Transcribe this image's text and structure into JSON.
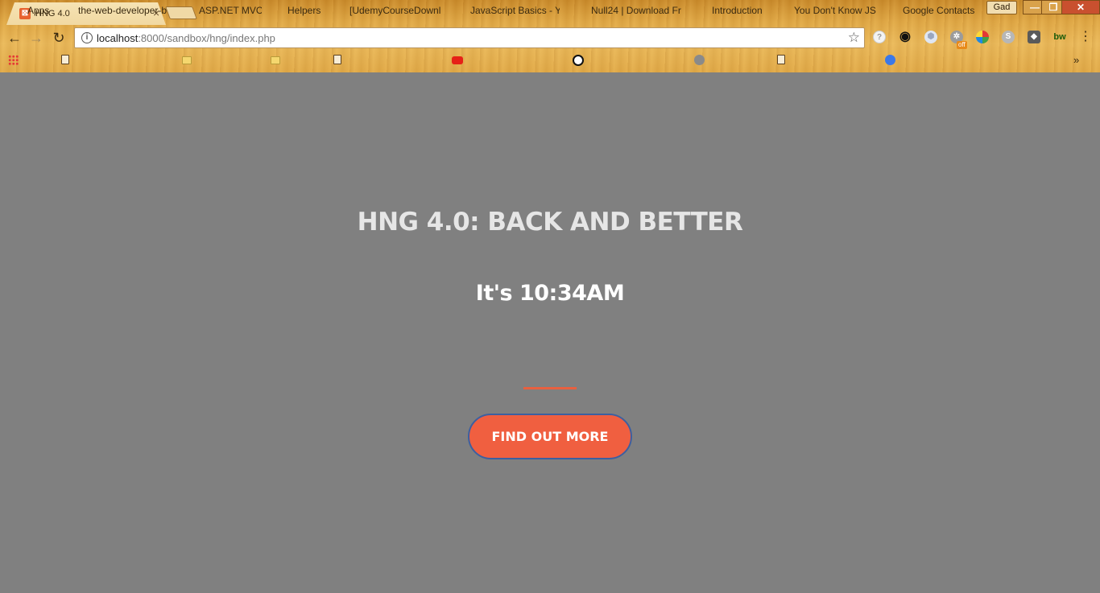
{
  "browser": {
    "tab": {
      "title": "HNG 4.0",
      "close": "×"
    },
    "profile": "Gad",
    "window_controls": {
      "minimize": "—",
      "maximize": "❐",
      "close": "✕"
    },
    "address": {
      "host": "localhost",
      "rest": ":8000/sandbox/hng/index.php"
    },
    "bookmarks": [
      {
        "label": "Apps",
        "icon": "apps-grid-icon"
      },
      {
        "label": "the-web-developer-b",
        "icon": "page-icon"
      },
      {
        "label": "ASP.NET MVC",
        "icon": "folder-icon"
      },
      {
        "label": "Helpers",
        "icon": "folder-icon"
      },
      {
        "label": "[UdemyCourseDownl",
        "icon": "page-icon"
      },
      {
        "label": "JavaScript Basics - Yo",
        "icon": "youtube-icon"
      },
      {
        "label": "Null24 | Download Fr",
        "icon": "clock-icon"
      },
      {
        "label": "Introduction",
        "icon": "gear-icon"
      },
      {
        "label": "You Don't Know JS",
        "icon": "page-icon"
      },
      {
        "label": "Google Contacts",
        "icon": "contacts-icon"
      }
    ],
    "extension_badge": "off",
    "extension_bw": "bw",
    "more_bookmarks": "»"
  },
  "page": {
    "title": "HNG 4.0: BACK AND BETTER",
    "time_text": "It's 10:34AM",
    "cta_label": "FIND OUT MORE",
    "accent_color": "#f05f40",
    "background_color": "#808080"
  }
}
